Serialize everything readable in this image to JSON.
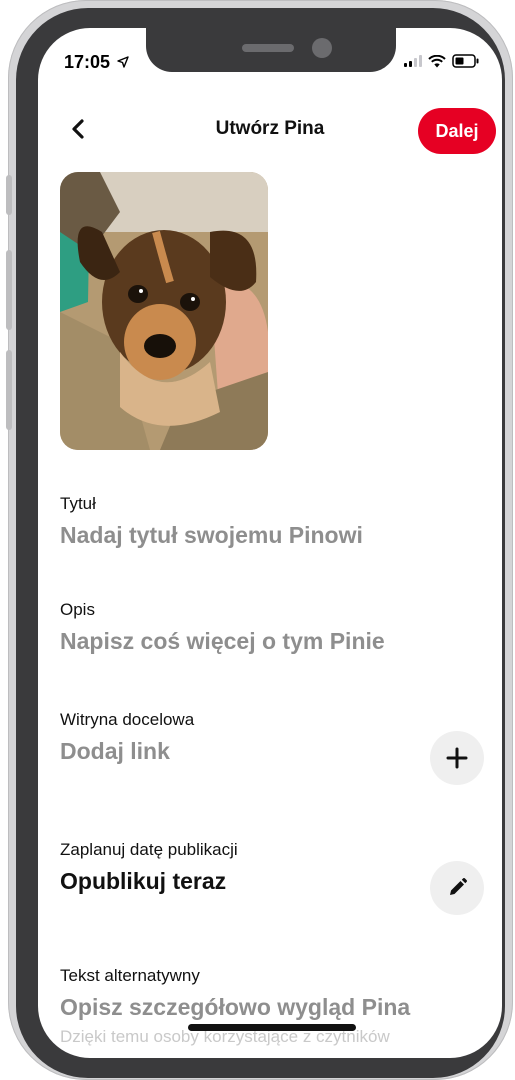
{
  "status": {
    "time": "17:05"
  },
  "header": {
    "title": "Utwórz Pina",
    "next_label": "Dalej"
  },
  "fields": {
    "title": {
      "label": "Tytuł",
      "placeholder": "Nadaj tytuł swojemu Pinowi"
    },
    "description": {
      "label": "Opis",
      "placeholder": "Napisz coś więcej o tym Pinie"
    },
    "link": {
      "label": "Witryna docelowa",
      "placeholder": "Dodaj link"
    },
    "schedule": {
      "label": "Zaplanuj datę publikacji",
      "value": "Opublikuj teraz"
    },
    "alt_text": {
      "label": "Tekst alternatywny",
      "placeholder": "Opisz szczegółowo wygląd Pina",
      "helper": "Dzięki temu osoby korzystające z czytników"
    }
  },
  "icons": {
    "back": "chevron-left-icon",
    "add": "plus-icon",
    "edit": "pencil-icon",
    "location": "location-arrow-icon",
    "signal": "signal-icon",
    "wifi": "wifi-icon",
    "battery": "battery-icon"
  },
  "colors": {
    "accent": "#e60023",
    "placeholder": "#8e8e8e",
    "round_button_bg": "#efefef"
  }
}
